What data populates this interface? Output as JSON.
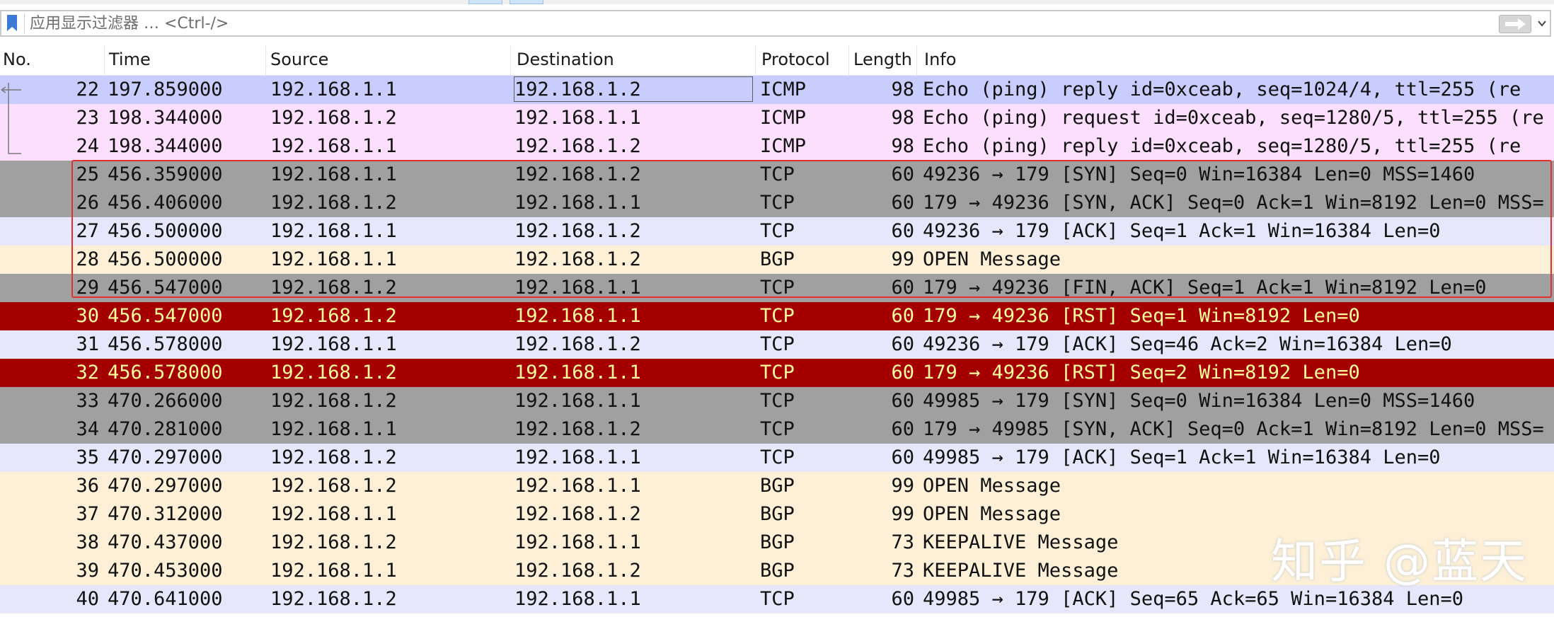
{
  "filter": {
    "placeholder": "应用显示过滤器 … <Ctrl-/>",
    "value": ""
  },
  "columns": [
    "No.",
    "Time",
    "Source",
    "Destination",
    "Protocol",
    "Length",
    "Info"
  ],
  "colors": {
    "icmp": "#c8cdfd",
    "icmp_request": "#fcdffd",
    "tcp_syn_fin": "#a0a0a0",
    "tcp": "#e6e7fb",
    "bgp": "#fdf0d6",
    "rst_bg": "#a40000",
    "rst_fg": "#fffc9c",
    "highlight_box": "#e03030"
  },
  "packets": [
    {
      "no": "22",
      "time": "197.859000",
      "src": "192.168.1.1",
      "dst": "192.168.1.2",
      "proto": "ICMP",
      "len": "98",
      "info": "Echo (ping) reply    id=0xceab, seq=1024/4, ttl=255 (re",
      "style": "icmp"
    },
    {
      "no": "23",
      "time": "198.344000",
      "src": "192.168.1.2",
      "dst": "192.168.1.1",
      "proto": "ICMP",
      "len": "98",
      "info": "Echo (ping) request  id=0xceab, seq=1280/5, ttl=255 (re",
      "style": "icmp_request"
    },
    {
      "no": "24",
      "time": "198.344000",
      "src": "192.168.1.1",
      "dst": "192.168.1.2",
      "proto": "ICMP",
      "len": "98",
      "info": "Echo (ping) reply    id=0xceab, seq=1280/5, ttl=255 (re",
      "style": "icmp_request"
    },
    {
      "no": "25",
      "time": "456.359000",
      "src": "192.168.1.1",
      "dst": "192.168.1.2",
      "proto": "TCP",
      "len": "60",
      "info": "49236 → 179 [SYN] Seq=0 Win=16384 Len=0 MSS=1460",
      "style": "tcp_syn_fin"
    },
    {
      "no": "26",
      "time": "456.406000",
      "src": "192.168.1.2",
      "dst": "192.168.1.1",
      "proto": "TCP",
      "len": "60",
      "info": "179 → 49236 [SYN, ACK] Seq=0 Ack=1 Win=8192 Len=0 MSS=",
      "style": "tcp_syn_fin"
    },
    {
      "no": "27",
      "time": "456.500000",
      "src": "192.168.1.1",
      "dst": "192.168.1.2",
      "proto": "TCP",
      "len": "60",
      "info": "49236 → 179 [ACK] Seq=1 Ack=1 Win=16384 Len=0",
      "style": "tcp"
    },
    {
      "no": "28",
      "time": "456.500000",
      "src": "192.168.1.1",
      "dst": "192.168.1.2",
      "proto": "BGP",
      "len": "99",
      "info": "OPEN Message",
      "style": "bgp"
    },
    {
      "no": "29",
      "time": "456.547000",
      "src": "192.168.1.2",
      "dst": "192.168.1.1",
      "proto": "TCP",
      "len": "60",
      "info": "179 → 49236 [FIN, ACK] Seq=1 Ack=1 Win=8192 Len=0",
      "style": "tcp_syn_fin"
    },
    {
      "no": "30",
      "time": "456.547000",
      "src": "192.168.1.2",
      "dst": "192.168.1.1",
      "proto": "TCP",
      "len": "60",
      "info": "179 → 49236 [RST] Seq=1 Win=8192 Len=0",
      "style": "rst"
    },
    {
      "no": "31",
      "time": "456.578000",
      "src": "192.168.1.1",
      "dst": "192.168.1.2",
      "proto": "TCP",
      "len": "60",
      "info": "49236 → 179 [ACK] Seq=46 Ack=2 Win=16384 Len=0",
      "style": "tcp"
    },
    {
      "no": "32",
      "time": "456.578000",
      "src": "192.168.1.2",
      "dst": "192.168.1.1",
      "proto": "TCP",
      "len": "60",
      "info": "179 → 49236 [RST] Seq=2 Win=8192 Len=0",
      "style": "rst"
    },
    {
      "no": "33",
      "time": "470.266000",
      "src": "192.168.1.2",
      "dst": "192.168.1.1",
      "proto": "TCP",
      "len": "60",
      "info": "49985 → 179 [SYN] Seq=0 Win=16384 Len=0 MSS=1460",
      "style": "tcp_syn_fin"
    },
    {
      "no": "34",
      "time": "470.281000",
      "src": "192.168.1.1",
      "dst": "192.168.1.2",
      "proto": "TCP",
      "len": "60",
      "info": "179 → 49985 [SYN, ACK] Seq=0 Ack=1 Win=8192 Len=0 MSS=",
      "style": "tcp_syn_fin"
    },
    {
      "no": "35",
      "time": "470.297000",
      "src": "192.168.1.2",
      "dst": "192.168.1.1",
      "proto": "TCP",
      "len": "60",
      "info": "49985 → 179 [ACK] Seq=1 Ack=1 Win=16384 Len=0",
      "style": "tcp"
    },
    {
      "no": "36",
      "time": "470.297000",
      "src": "192.168.1.2",
      "dst": "192.168.1.1",
      "proto": "BGP",
      "len": "99",
      "info": "OPEN Message",
      "style": "bgp"
    },
    {
      "no": "37",
      "time": "470.312000",
      "src": "192.168.1.1",
      "dst": "192.168.1.2",
      "proto": "BGP",
      "len": "99",
      "info": "OPEN Message",
      "style": "bgp"
    },
    {
      "no": "38",
      "time": "470.437000",
      "src": "192.168.1.2",
      "dst": "192.168.1.1",
      "proto": "BGP",
      "len": "73",
      "info": "KEEPALIVE Message",
      "style": "bgp"
    },
    {
      "no": "39",
      "time": "470.453000",
      "src": "192.168.1.1",
      "dst": "192.168.1.2",
      "proto": "BGP",
      "len": "73",
      "info": "KEEPALIVE Message",
      "style": "bgp"
    },
    {
      "no": "40",
      "time": "470.641000",
      "src": "192.168.1.2",
      "dst": "192.168.1.1",
      "proto": "TCP",
      "len": "60",
      "info": "49985 → 179 [ACK] Seq=65 Ack=65 Win=16384 Len=0",
      "style": "tcp"
    }
  ],
  "watermark": "知乎 @蓝天"
}
